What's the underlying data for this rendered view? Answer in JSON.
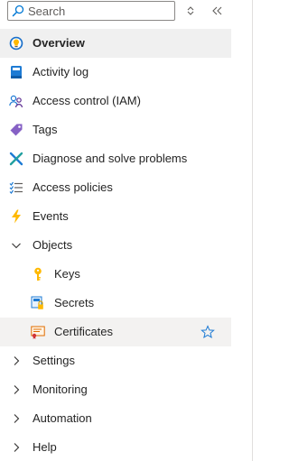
{
  "search": {
    "placeholder": "Search"
  },
  "toolbar": {
    "sort_icon": "up-down-icon",
    "collapse_icon": "double-chevron-left-icon"
  },
  "colors": {
    "accent": "#0078d4",
    "selected_bg": "#f0f0f0",
    "border": "#8a8886"
  },
  "menu": {
    "items": [
      {
        "label": "Overview",
        "icon": "lightbulb-icon",
        "selected": true
      },
      {
        "label": "Activity log",
        "icon": "book-icon"
      },
      {
        "label": "Access control (IAM)",
        "icon": "people-icon"
      },
      {
        "label": "Tags",
        "icon": "tag-icon"
      },
      {
        "label": "Diagnose and solve problems",
        "icon": "wrench-icon"
      },
      {
        "label": "Access policies",
        "icon": "list-check-icon"
      },
      {
        "label": "Events",
        "icon": "lightning-icon"
      },
      {
        "label": "Objects",
        "icon": "chevron-down-icon",
        "expanded": true
      },
      {
        "label": "Keys",
        "icon": "key-icon"
      },
      {
        "label": "Secrets",
        "icon": "secret-icon"
      },
      {
        "label": "Certificates",
        "icon": "certificate-icon",
        "favorite_icon": "star-icon"
      },
      {
        "label": "Settings",
        "icon": "chevron-right-icon"
      },
      {
        "label": "Monitoring",
        "icon": "chevron-right-icon"
      },
      {
        "label": "Automation",
        "icon": "chevron-right-icon"
      },
      {
        "label": "Help",
        "icon": "chevron-right-icon"
      }
    ]
  }
}
